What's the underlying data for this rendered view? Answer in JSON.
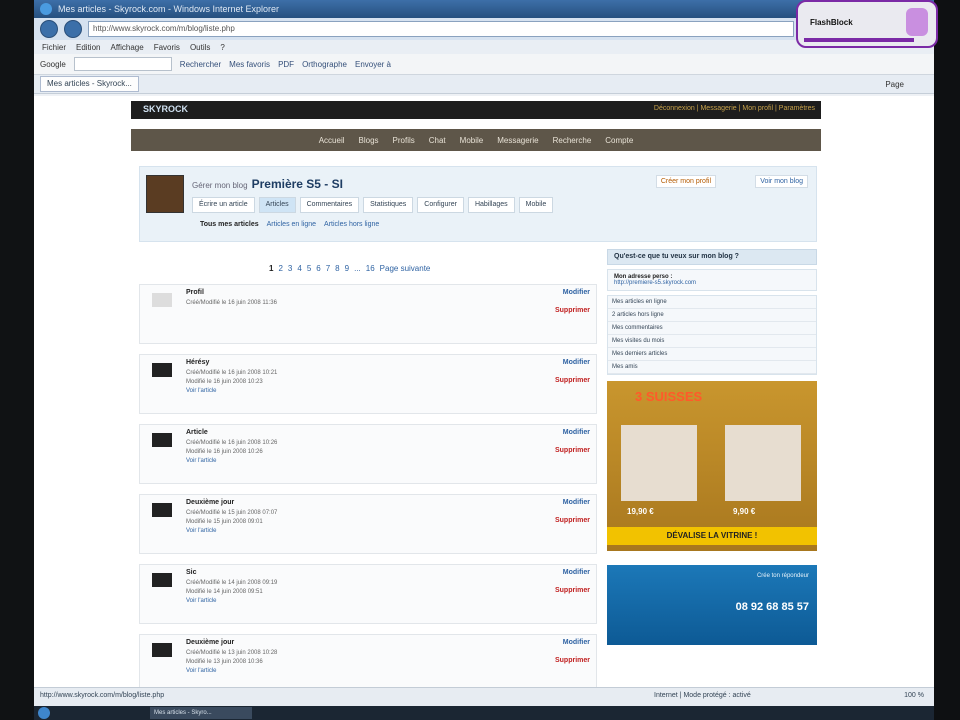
{
  "browser": {
    "title": "Mes articles - Skyrock.com - Windows Internet Explorer",
    "address": "http://www.skyrock.com/m/blog/liste.php",
    "menu": [
      "Fichier",
      "Edition",
      "Affichage",
      "Favoris",
      "Outils",
      "?"
    ],
    "google_label": "Google",
    "toolbar_buttons": [
      "Rechercher",
      "Mes favoris",
      "PDF",
      "Orthographe",
      "Envoyer à"
    ],
    "tab_label": "Mes articles - Skyrock...",
    "page_menu": "Page",
    "status_url": "http://www.skyrock.com/m/blog/liste.php",
    "status_zone": "Internet | Mode protégé : activé",
    "zoom": "100 %"
  },
  "skyrock": {
    "logo": "SKYROCK",
    "top_links": "Déconnexion | Messagerie | Mon profil | Paramètres",
    "nav": [
      "Accueil",
      "Blogs",
      "Profils",
      "Chat",
      "Mobile",
      "Messagerie",
      "Recherche",
      "Compte"
    ]
  },
  "profile": {
    "pre_title": "Gérer mon blog",
    "title": "Première S5 - SI",
    "link_profile": "Créer mon profil",
    "link_blog": "Voir mon blog",
    "tabs": [
      "Écrire un article",
      "Articles",
      "Commentaires",
      "Statistiques",
      "Configurer",
      "Habillages",
      "Mobile"
    ],
    "active_tab_index": 1,
    "subtabs": [
      "Tous mes articles",
      "Articles en ligne",
      "Articles hors ligne"
    ]
  },
  "pager": {
    "pages": [
      "1",
      "2",
      "3",
      "4",
      "5",
      "6",
      "7",
      "8",
      "9",
      "...",
      "16"
    ],
    "next": "Page suivante"
  },
  "articles": [
    {
      "title": "Profil",
      "l1": "Créé/Modifié le 16 juin 2008 11:36",
      "l2": "",
      "l3": "",
      "thumb": "light"
    },
    {
      "title": "Hérésy",
      "l1": "Créé/Modifié le 16 juin 2008 10:21",
      "l2": "Modifié le 16 juin 2008 10:23",
      "l3": "Voir l'article",
      "thumb": "dark"
    },
    {
      "title": "Article",
      "l1": "Créé/Modifié le 16 juin 2008 10:26",
      "l2": "Modifié le 16 juin 2008 10:26",
      "l3": "Voir l'article",
      "thumb": "dark"
    },
    {
      "title": "Deuxième jour",
      "l1": "Créé/Modifié le 15 juin 2008 07:07",
      "l2": "Modifié le 15 juin 2008 09:01",
      "l3": "Voir l'article",
      "thumb": "dark"
    },
    {
      "title": "Sic",
      "l1": "Créé/Modifié le 14 juin 2008 09:19",
      "l2": "Modifié le 14 juin 2008 09:51",
      "l3": "Voir l'article",
      "thumb": "dark"
    },
    {
      "title": "Deuxième jour",
      "l1": "Créé/Modifié le 13 juin 2008 10:28",
      "l2": "Modifié le 13 juin 2008 10:36",
      "l3": "Voir l'article",
      "thumb": "dark"
    }
  ],
  "actions": {
    "modify": "Modifier",
    "delete": "Supprimer"
  },
  "sidebar": {
    "head": "Qu'est-ce que tu veux sur mon blog ?",
    "address_label": "Mon adresse perso :",
    "address_url": "http://premiere-s5.skyrock.com",
    "items": [
      "Mes articles en ligne",
      "2 articles hors ligne",
      "Mes commentaires",
      "Mes visites du mois",
      "Mes derniers articles",
      "Mes amis"
    ]
  },
  "ads": {
    "brand": "3 SUISSES",
    "price1": "19,90 €",
    "price2": "9,90 €",
    "cta": "DÉVALISE LA VITRINE !",
    "ad2_text": "Crée ton répondeur",
    "ad2_phone": "08 92 68 85 57"
  },
  "taskbar": {
    "task": "Mes articles - Skyro..."
  },
  "flashblock": {
    "label": "FlashBlock"
  }
}
